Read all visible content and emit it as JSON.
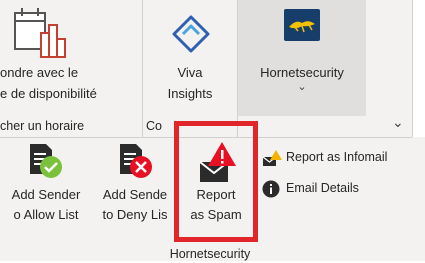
{
  "ribbon_top": {
    "scheduling": {
      "line1": "ondre avec le",
      "line2": "e de disponibilité",
      "group_label": "cher un horaire"
    },
    "viva": {
      "line1": "Viva",
      "line2": "Insights",
      "group_label": "Co"
    },
    "hornet": {
      "line1": "Hornetsecurity",
      "chevron": "⌄"
    },
    "collapse_chevron": "⌄"
  },
  "ribbon_bottom": {
    "allow": {
      "line1": "Add Sender",
      "line2": "o Allow List"
    },
    "deny": {
      "line1": "Add Sende",
      "line2": "to Deny Lis"
    },
    "spam": {
      "line1": "Report",
      "line2": "as Spam"
    },
    "infomail": {
      "label": "Report as Infomail"
    },
    "details": {
      "label": "Email Details"
    },
    "group_label": "Hornetsecurity"
  },
  "colors": {
    "highlight": "#e0262b",
    "accent_green": "#7cc13c",
    "accent_red": "#e81123",
    "brand_blue": "#1e4f8a"
  }
}
